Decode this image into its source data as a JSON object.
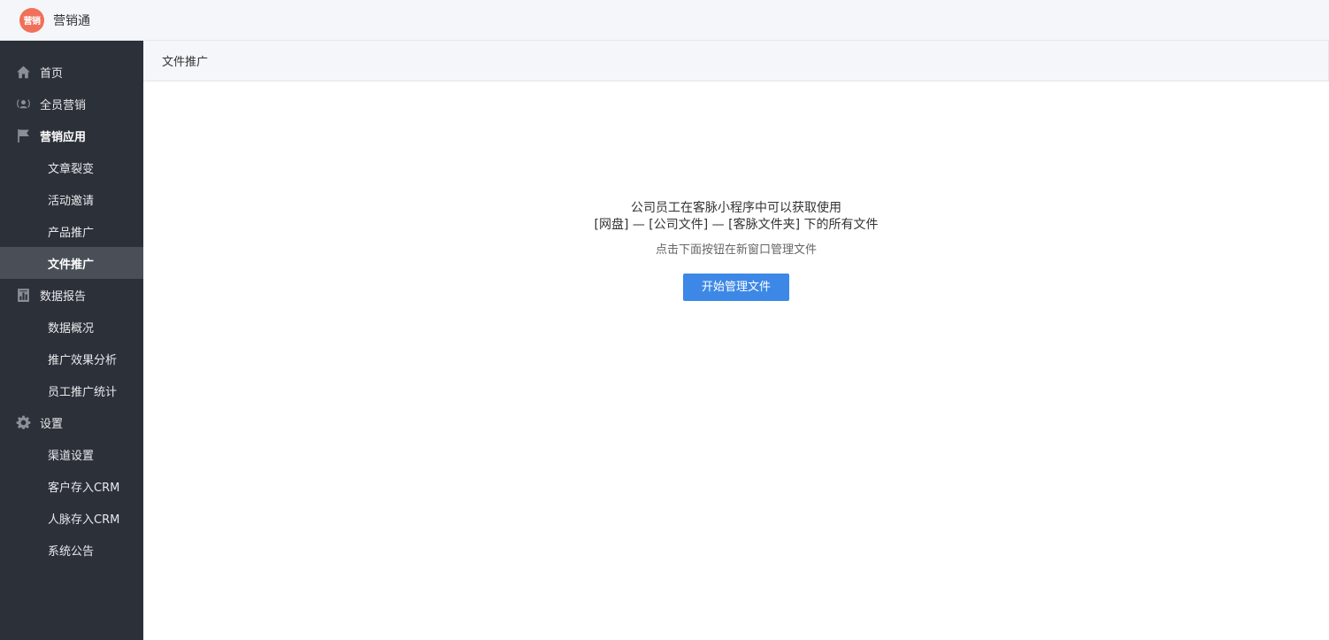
{
  "app": {
    "logo_text": "营销",
    "title": "营销通"
  },
  "sidebar": {
    "items": [
      {
        "label": "首页",
        "level": "top",
        "icon": "home-icon"
      },
      {
        "label": "全员营销",
        "level": "top",
        "icon": "user-broadcast-icon"
      },
      {
        "label": "营销应用",
        "level": "top",
        "icon": "flag-icon"
      },
      {
        "label": "文章裂变",
        "level": "sub"
      },
      {
        "label": "活动邀请",
        "level": "sub"
      },
      {
        "label": "产品推广",
        "level": "sub"
      },
      {
        "label": "文件推广",
        "level": "sub",
        "active": true
      },
      {
        "label": "数据报告",
        "level": "top",
        "icon": "report-icon"
      },
      {
        "label": "数据概况",
        "level": "sub"
      },
      {
        "label": "推广效果分析",
        "level": "sub"
      },
      {
        "label": "员工推广统计",
        "level": "sub"
      },
      {
        "label": "设置",
        "level": "top",
        "icon": "gear-icon"
      },
      {
        "label": "渠道设置",
        "level": "sub"
      },
      {
        "label": "客户存入CRM",
        "level": "sub"
      },
      {
        "label": "人脉存入CRM",
        "level": "sub"
      },
      {
        "label": "系统公告",
        "level": "sub"
      }
    ]
  },
  "main": {
    "header_title": "文件推广",
    "line1": "公司员工在客脉小程序中可以获取使用",
    "line2": "[网盘] — [公司文件] — [客脉文件夹] 下的所有文件",
    "hint": "点击下面按钮在新窗口管理文件",
    "button_label": "开始管理文件"
  },
  "colors": {
    "sidebar_bg": "#2c3038",
    "sidebar_active": "#4a4f57",
    "accent": "#3d88e6",
    "logo": "#f0705a"
  }
}
